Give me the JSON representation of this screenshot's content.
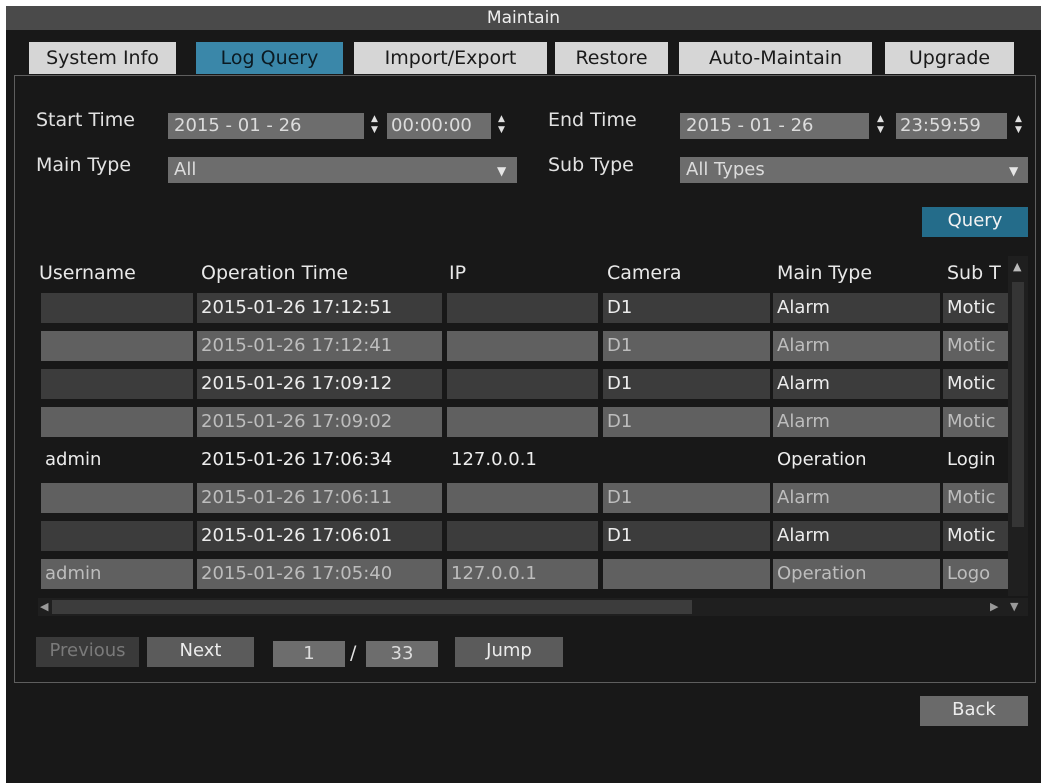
{
  "window": {
    "title": "Maintain"
  },
  "tabs": [
    {
      "label": "System Info",
      "active": false
    },
    {
      "label": "Log Query",
      "active": true
    },
    {
      "label": "Import/Export",
      "active": false
    },
    {
      "label": "Restore",
      "active": false
    },
    {
      "label": "Auto-Maintain",
      "active": false
    },
    {
      "label": "Upgrade",
      "active": false
    }
  ],
  "filters": {
    "start_time_label": "Start Time",
    "start_date": "2015 -  01 -  26",
    "start_clock": "00:00:00",
    "end_time_label": "End Time",
    "end_date": "2015 -  01 -  26",
    "end_clock": "23:59:59",
    "main_type_label": "Main Type",
    "main_type_value": "All",
    "sub_type_label": "Sub Type",
    "sub_type_value": "All Types",
    "query_label": "Query"
  },
  "table": {
    "columns": [
      "Username",
      "Operation Time",
      "IP",
      "Camera",
      "Main Type",
      "Sub T"
    ],
    "rows": [
      [
        "",
        "2015-01-26 17:12:51",
        "",
        "D1",
        "Alarm",
        "Motic"
      ],
      [
        "",
        "2015-01-26 17:12:41",
        "",
        "D1",
        "Alarm",
        "Motic"
      ],
      [
        "",
        "2015-01-26 17:09:12",
        "",
        "D1",
        "Alarm",
        "Motic"
      ],
      [
        "",
        "2015-01-26 17:09:02",
        "",
        "D1",
        "Alarm",
        "Motic"
      ],
      [
        "admin",
        "2015-01-26 17:06:34",
        "127.0.0.1",
        "",
        "Operation",
        "Login"
      ],
      [
        "",
        "2015-01-26 17:06:11",
        "",
        "D1",
        "Alarm",
        "Motic"
      ],
      [
        "",
        "2015-01-26 17:06:01",
        "",
        "D1",
        "Alarm",
        "Motic"
      ],
      [
        "admin",
        "2015-01-26 17:05:40",
        "127.0.0.1",
        "",
        "Operation",
        "Logo"
      ]
    ]
  },
  "pagination": {
    "previous_label": "Previous",
    "next_label": "Next",
    "current_page": "1",
    "separator": "/",
    "total_pages": "33",
    "jump_label": "Jump"
  },
  "footer": {
    "back_label": "Back"
  },
  "colors": {
    "accent": "#246c8a",
    "tab_active": "#3a87a9",
    "background": "#181818"
  }
}
